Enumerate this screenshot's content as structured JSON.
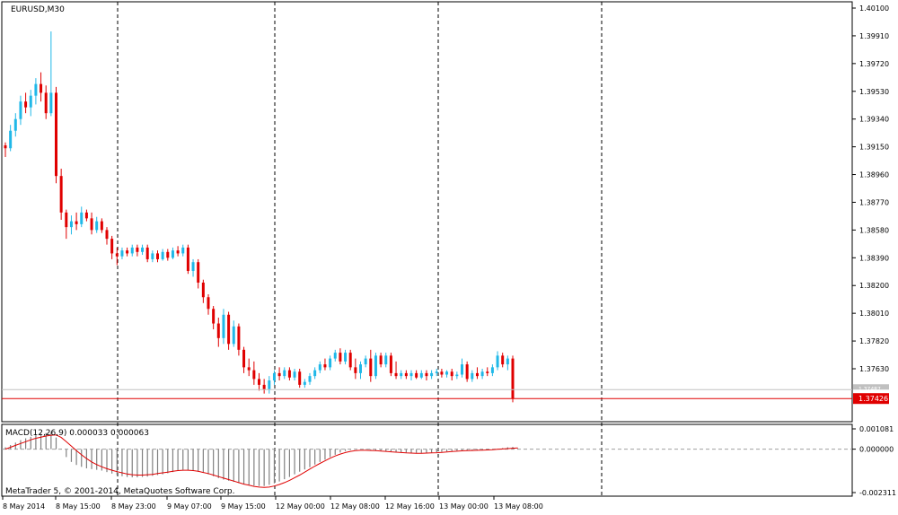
{
  "chart_data": [
    {
      "type": "candlestick",
      "title": "EURUSD,M30",
      "ylim": [
        1.3733,
        1.4012
      ],
      "y_ticks": [
        "1.40100",
        "1.39910",
        "1.39720",
        "1.39530",
        "1.39340",
        "1.39150",
        "1.38960",
        "1.38770",
        "1.38580",
        "1.38390",
        "1.38200",
        "1.38010",
        "1.37820",
        "1.37630"
      ],
      "x_ticks": [
        "8 May 2014",
        "8 May 15:00",
        "8 May 23:00",
        "9 May 07:00",
        "9 May 15:00",
        "12 May 00:00",
        "12 May 08:00",
        "12 May 16:00",
        "13 May 00:00",
        "13 May 08:00"
      ],
      "current_price": "1.37426",
      "bid_line": "1.37487",
      "colors": {
        "bull": "#20b8e8",
        "bear": "#e00000",
        "price_line": "#e00000",
        "bid_line": "#c0c0c0",
        "separator": "#000000"
      },
      "candles": [
        {
          "o": 1.3916,
          "h": 1.3918,
          "l": 1.3908,
          "c": 1.3914
        },
        {
          "o": 1.3914,
          "h": 1.393,
          "l": 1.3912,
          "c": 1.3926
        },
        {
          "o": 1.3926,
          "h": 1.3938,
          "l": 1.3922,
          "c": 1.3934
        },
        {
          "o": 1.3934,
          "h": 1.395,
          "l": 1.393,
          "c": 1.3946
        },
        {
          "o": 1.3946,
          "h": 1.3952,
          "l": 1.3938,
          "c": 1.3942
        },
        {
          "o": 1.3942,
          "h": 1.3954,
          "l": 1.3936,
          "c": 1.395
        },
        {
          "o": 1.395,
          "h": 1.3962,
          "l": 1.3944,
          "c": 1.3958
        },
        {
          "o": 1.3958,
          "h": 1.3966,
          "l": 1.3946,
          "c": 1.3952
        },
        {
          "o": 1.3952,
          "h": 1.3957,
          "l": 1.3934,
          "c": 1.3938
        },
        {
          "o": 1.3938,
          "h": 1.3994,
          "l": 1.3936,
          "c": 1.3952
        },
        {
          "o": 1.3952,
          "h": 1.3956,
          "l": 1.389,
          "c": 1.3895
        },
        {
          "o": 1.3895,
          "h": 1.39,
          "l": 1.3865,
          "c": 1.387
        },
        {
          "o": 1.387,
          "h": 1.3872,
          "l": 1.3852,
          "c": 1.386
        },
        {
          "o": 1.386,
          "h": 1.3868,
          "l": 1.3855,
          "c": 1.3864
        },
        {
          "o": 1.3864,
          "h": 1.387,
          "l": 1.3858,
          "c": 1.3862
        },
        {
          "o": 1.3862,
          "h": 1.3874,
          "l": 1.386,
          "c": 1.387
        },
        {
          "o": 1.387,
          "h": 1.3872,
          "l": 1.3864,
          "c": 1.3866
        },
        {
          "o": 1.3866,
          "h": 1.387,
          "l": 1.3855,
          "c": 1.3858
        },
        {
          "o": 1.3858,
          "h": 1.3867,
          "l": 1.3856,
          "c": 1.3864
        },
        {
          "o": 1.3864,
          "h": 1.3866,
          "l": 1.3856,
          "c": 1.3858
        },
        {
          "o": 1.3858,
          "h": 1.386,
          "l": 1.3848,
          "c": 1.3852
        },
        {
          "o": 1.3852,
          "h": 1.3854,
          "l": 1.3838,
          "c": 1.3842
        },
        {
          "o": 1.3842,
          "h": 1.3846,
          "l": 1.3834,
          "c": 1.384
        },
        {
          "o": 1.384,
          "h": 1.3846,
          "l": 1.3838,
          "c": 1.3844
        },
        {
          "o": 1.3844,
          "h": 1.3846,
          "l": 1.384,
          "c": 1.3842
        },
        {
          "o": 1.3842,
          "h": 1.3848,
          "l": 1.384,
          "c": 1.3846
        },
        {
          "o": 1.3846,
          "h": 1.3848,
          "l": 1.384,
          "c": 1.3843
        },
        {
          "o": 1.3843,
          "h": 1.3848,
          "l": 1.3841,
          "c": 1.3846
        },
        {
          "o": 1.3846,
          "h": 1.3848,
          "l": 1.3836,
          "c": 1.3838
        },
        {
          "o": 1.3838,
          "h": 1.3844,
          "l": 1.3836,
          "c": 1.3842
        },
        {
          "o": 1.3842,
          "h": 1.3844,
          "l": 1.3836,
          "c": 1.3838
        },
        {
          "o": 1.3838,
          "h": 1.3845,
          "l": 1.3837,
          "c": 1.3843
        },
        {
          "o": 1.3843,
          "h": 1.3845,
          "l": 1.3837,
          "c": 1.3839
        },
        {
          "o": 1.3839,
          "h": 1.3846,
          "l": 1.3838,
          "c": 1.3844
        },
        {
          "o": 1.3844,
          "h": 1.3847,
          "l": 1.384,
          "c": 1.3842
        },
        {
          "o": 1.3842,
          "h": 1.3848,
          "l": 1.384,
          "c": 1.3846
        },
        {
          "o": 1.3846,
          "h": 1.3848,
          "l": 1.3828,
          "c": 1.383
        },
        {
          "o": 1.383,
          "h": 1.3838,
          "l": 1.3826,
          "c": 1.3836
        },
        {
          "o": 1.3836,
          "h": 1.3838,
          "l": 1.3818,
          "c": 1.3822
        },
        {
          "o": 1.3822,
          "h": 1.3824,
          "l": 1.3808,
          "c": 1.3812
        },
        {
          "o": 1.3812,
          "h": 1.3814,
          "l": 1.38,
          "c": 1.3804
        },
        {
          "o": 1.3804,
          "h": 1.3806,
          "l": 1.379,
          "c": 1.3794
        },
        {
          "o": 1.3794,
          "h": 1.3798,
          "l": 1.3778,
          "c": 1.3784
        },
        {
          "o": 1.3784,
          "h": 1.3804,
          "l": 1.378,
          "c": 1.38
        },
        {
          "o": 1.38,
          "h": 1.3802,
          "l": 1.3776,
          "c": 1.378
        },
        {
          "o": 1.378,
          "h": 1.3796,
          "l": 1.3778,
          "c": 1.3792
        },
        {
          "o": 1.3792,
          "h": 1.3794,
          "l": 1.3772,
          "c": 1.3776
        },
        {
          "o": 1.3776,
          "h": 1.3778,
          "l": 1.376,
          "c": 1.3764
        },
        {
          "o": 1.3764,
          "h": 1.377,
          "l": 1.3758,
          "c": 1.3762
        },
        {
          "o": 1.3762,
          "h": 1.3768,
          "l": 1.3752,
          "c": 1.3756
        },
        {
          "o": 1.3756,
          "h": 1.376,
          "l": 1.3748,
          "c": 1.3752
        },
        {
          "o": 1.3752,
          "h": 1.3756,
          "l": 1.3746,
          "c": 1.3749
        },
        {
          "o": 1.3749,
          "h": 1.3758,
          "l": 1.3746,
          "c": 1.3755
        },
        {
          "o": 1.3755,
          "h": 1.3762,
          "l": 1.3752,
          "c": 1.376
        },
        {
          "o": 1.376,
          "h": 1.3764,
          "l": 1.3755,
          "c": 1.3758
        },
        {
          "o": 1.3758,
          "h": 1.3764,
          "l": 1.3756,
          "c": 1.3762
        },
        {
          "o": 1.3762,
          "h": 1.3764,
          "l": 1.3755,
          "c": 1.3757
        },
        {
          "o": 1.3757,
          "h": 1.3763,
          "l": 1.3755,
          "c": 1.3761
        },
        {
          "o": 1.3761,
          "h": 1.3763,
          "l": 1.375,
          "c": 1.3752
        },
        {
          "o": 1.3752,
          "h": 1.3756,
          "l": 1.375,
          "c": 1.3754
        },
        {
          "o": 1.3754,
          "h": 1.376,
          "l": 1.3752,
          "c": 1.3758
        },
        {
          "o": 1.3758,
          "h": 1.3764,
          "l": 1.3756,
          "c": 1.3762
        },
        {
          "o": 1.3762,
          "h": 1.3768,
          "l": 1.376,
          "c": 1.3766
        },
        {
          "o": 1.3766,
          "h": 1.377,
          "l": 1.3762,
          "c": 1.3764
        },
        {
          "o": 1.3764,
          "h": 1.3772,
          "l": 1.3762,
          "c": 1.377
        },
        {
          "o": 1.377,
          "h": 1.3776,
          "l": 1.3768,
          "c": 1.3774
        },
        {
          "o": 1.3774,
          "h": 1.3777,
          "l": 1.3766,
          "c": 1.3768
        },
        {
          "o": 1.3768,
          "h": 1.3776,
          "l": 1.3766,
          "c": 1.3774
        },
        {
          "o": 1.3774,
          "h": 1.3776,
          "l": 1.3762,
          "c": 1.3764
        },
        {
          "o": 1.3764,
          "h": 1.377,
          "l": 1.3756,
          "c": 1.376
        },
        {
          "o": 1.376,
          "h": 1.3768,
          "l": 1.3756,
          "c": 1.3766
        },
        {
          "o": 1.3766,
          "h": 1.3772,
          "l": 1.3764,
          "c": 1.377
        },
        {
          "o": 1.377,
          "h": 1.3776,
          "l": 1.3754,
          "c": 1.3758
        },
        {
          "o": 1.3758,
          "h": 1.3774,
          "l": 1.3756,
          "c": 1.3772
        },
        {
          "o": 1.3772,
          "h": 1.3774,
          "l": 1.3764,
          "c": 1.3766
        },
        {
          "o": 1.3766,
          "h": 1.3774,
          "l": 1.3764,
          "c": 1.3772
        },
        {
          "o": 1.3772,
          "h": 1.3774,
          "l": 1.3758,
          "c": 1.376
        },
        {
          "o": 1.376,
          "h": 1.3768,
          "l": 1.3756,
          "c": 1.3758
        },
        {
          "o": 1.3758,
          "h": 1.3762,
          "l": 1.3756,
          "c": 1.376
        },
        {
          "o": 1.376,
          "h": 1.3762,
          "l": 1.3756,
          "c": 1.3758
        },
        {
          "o": 1.3758,
          "h": 1.3762,
          "l": 1.3755,
          "c": 1.376
        },
        {
          "o": 1.376,
          "h": 1.3762,
          "l": 1.3756,
          "c": 1.3757
        },
        {
          "o": 1.3757,
          "h": 1.3762,
          "l": 1.3756,
          "c": 1.376
        },
        {
          "o": 1.376,
          "h": 1.3762,
          "l": 1.3755,
          "c": 1.3758
        },
        {
          "o": 1.3758,
          "h": 1.3762,
          "l": 1.3756,
          "c": 1.376
        },
        {
          "o": 1.376,
          "h": 1.3763,
          "l": 1.3758,
          "c": 1.3761
        },
        {
          "o": 1.3761,
          "h": 1.3763,
          "l": 1.3757,
          "c": 1.3759
        },
        {
          "o": 1.3759,
          "h": 1.3762,
          "l": 1.3757,
          "c": 1.3761
        },
        {
          "o": 1.3761,
          "h": 1.3763,
          "l": 1.3755,
          "c": 1.3758
        },
        {
          "o": 1.3758,
          "h": 1.3761,
          "l": 1.3756,
          "c": 1.3759
        },
        {
          "o": 1.3759,
          "h": 1.377,
          "l": 1.3757,
          "c": 1.3766
        },
        {
          "o": 1.3766,
          "h": 1.3768,
          "l": 1.3754,
          "c": 1.3756
        },
        {
          "o": 1.3756,
          "h": 1.3762,
          "l": 1.3754,
          "c": 1.376
        },
        {
          "o": 1.376,
          "h": 1.3764,
          "l": 1.3756,
          "c": 1.3758
        },
        {
          "o": 1.3758,
          "h": 1.3763,
          "l": 1.3756,
          "c": 1.3761
        },
        {
          "o": 1.3761,
          "h": 1.3764,
          "l": 1.3758,
          "c": 1.376
        },
        {
          "o": 1.376,
          "h": 1.3766,
          "l": 1.3758,
          "c": 1.3764
        },
        {
          "o": 1.3764,
          "h": 1.3775,
          "l": 1.3762,
          "c": 1.3772
        },
        {
          "o": 1.3772,
          "h": 1.3774,
          "l": 1.3764,
          "c": 1.3766
        },
        {
          "o": 1.3766,
          "h": 1.3772,
          "l": 1.3762,
          "c": 1.377
        },
        {
          "o": 1.377,
          "h": 1.3772,
          "l": 1.374,
          "c": 1.37426
        }
      ],
      "macd": {
        "label": "MACD(12,26,9) 0.000033 0.000063",
        "ylim": [
          -0.002311,
          0.001081
        ],
        "y_ticks": [
          "0.001081",
          "0.000000",
          "-0.002311"
        ],
        "histogram": [
          0.0001,
          0.00022,
          0.00035,
          0.00048,
          0.00058,
          0.00066,
          0.00074,
          0.00082,
          0.00086,
          0.00092,
          0.00062,
          2e-05,
          -0.00042,
          -0.00068,
          -0.00084,
          -0.00094,
          -0.00102,
          -0.00106,
          -0.0011,
          -0.00114,
          -0.00122,
          -0.0013,
          -0.00138,
          -0.00144,
          -0.00148,
          -0.0015,
          -0.0015,
          -0.00148,
          -0.00146,
          -0.00142,
          -0.00138,
          -0.00134,
          -0.00128,
          -0.00122,
          -0.00116,
          -0.0011,
          -0.00112,
          -0.00116,
          -0.0012,
          -0.00126,
          -0.00134,
          -0.00144,
          -0.00154,
          -0.00162,
          -0.00168,
          -0.00174,
          -0.0018,
          -0.00186,
          -0.0019,
          -0.00194,
          -0.00196,
          -0.00196,
          -0.0019,
          -0.00182,
          -0.00172,
          -0.0016,
          -0.00148,
          -0.00134,
          -0.0012,
          -0.00108,
          -0.00096,
          -0.00082,
          -0.00068,
          -0.00056,
          -0.00042,
          -0.0003,
          -0.00018,
          -0.0001,
          -4e-05,
          -1e-05,
          0.0,
          -2e-05,
          -4e-05,
          -6e-05,
          -8e-05,
          -0.0001,
          -0.00012,
          -0.00014,
          -0.00016,
          -0.00018,
          -0.0002,
          -0.0002,
          -0.0002,
          -0.00019,
          -0.00018,
          -0.00016,
          -0.00014,
          -0.00012,
          -0.0001,
          -8e-05,
          -6e-05,
          -6e-05,
          -6e-05,
          -5e-05,
          -4e-05,
          -2e-05,
          0.0,
          2e-05,
          6e-05,
          0.0001,
          0.00012,
          3e-05
        ],
        "signal": [
          0.0,
          0.0001,
          0.0002,
          0.0003,
          0.0004,
          0.0005,
          0.00058,
          0.00064,
          0.0007,
          0.00074,
          0.00076,
          0.00062,
          0.0004,
          0.00016,
          -8e-05,
          -0.0003,
          -0.0005,
          -0.00068,
          -0.00082,
          -0.00094,
          -0.00104,
          -0.00112,
          -0.0012,
          -0.00126,
          -0.00132,
          -0.00136,
          -0.00138,
          -0.00138,
          -0.00136,
          -0.00134,
          -0.0013,
          -0.00126,
          -0.00122,
          -0.00118,
          -0.00114,
          -0.00112,
          -0.00112,
          -0.00114,
          -0.00118,
          -0.00124,
          -0.0013,
          -0.00138,
          -0.00146,
          -0.00154,
          -0.00162,
          -0.0017,
          -0.00178,
          -0.00186,
          -0.00192,
          -0.00198,
          -0.00202,
          -0.00204,
          -0.00202,
          -0.00196,
          -0.00188,
          -0.00178,
          -0.00166,
          -0.00152,
          -0.00138,
          -0.00122,
          -0.00106,
          -0.0009,
          -0.00076,
          -0.00062,
          -0.00048,
          -0.00036,
          -0.00026,
          -0.00018,
          -0.00012,
          -8e-05,
          -6e-05,
          -6e-05,
          -7e-05,
          -8e-05,
          -0.0001,
          -0.00012,
          -0.00014,
          -0.00016,
          -0.00018,
          -0.0002,
          -0.00021,
          -0.00022,
          -0.00022,
          -0.00021,
          -0.0002,
          -0.00019,
          -0.00017,
          -0.00015,
          -0.00013,
          -0.00011,
          -9e-05,
          -8e-05,
          -7e-05,
          -6e-05,
          -5e-05,
          -4e-05,
          -3e-05,
          -1e-05,
          1e-05,
          3e-05,
          5e-05,
          6.3e-05
        ]
      }
    }
  ],
  "chart": {
    "symbol_label": "EURUSD,M30",
    "copyright": "MetaTrader 5, © 2001-2014, MetaQuotes Software Corp."
  }
}
